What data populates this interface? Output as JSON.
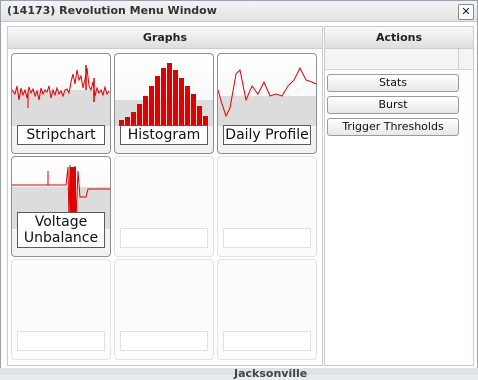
{
  "window": {
    "title": "(14173) Revolution Menu Window",
    "close_glyph": "✕"
  },
  "graphs": {
    "header": "Graphs",
    "tiles": [
      {
        "label": "Stripchart",
        "preview": "stripchart"
      },
      {
        "label": "Histogram",
        "preview": "histogram"
      },
      {
        "label": "Daily Profile",
        "preview": "daily-profile"
      },
      {
        "label": "Voltage Unbalance",
        "preview": "voltage-unbalance"
      },
      {
        "label": "",
        "preview": "none"
      },
      {
        "label": "",
        "preview": "none"
      },
      {
        "label": "",
        "preview": "none"
      },
      {
        "label": "",
        "preview": "none"
      },
      {
        "label": "",
        "preview": "none"
      }
    ]
  },
  "actions": {
    "header": "Actions",
    "buttons": [
      "Stats",
      "Burst",
      "Trigger Thresholds"
    ]
  },
  "background": {
    "partial_text": "Jacksonville"
  },
  "colors": {
    "plot_red": "#e00000",
    "plot_gray": "#d8d8d8"
  }
}
